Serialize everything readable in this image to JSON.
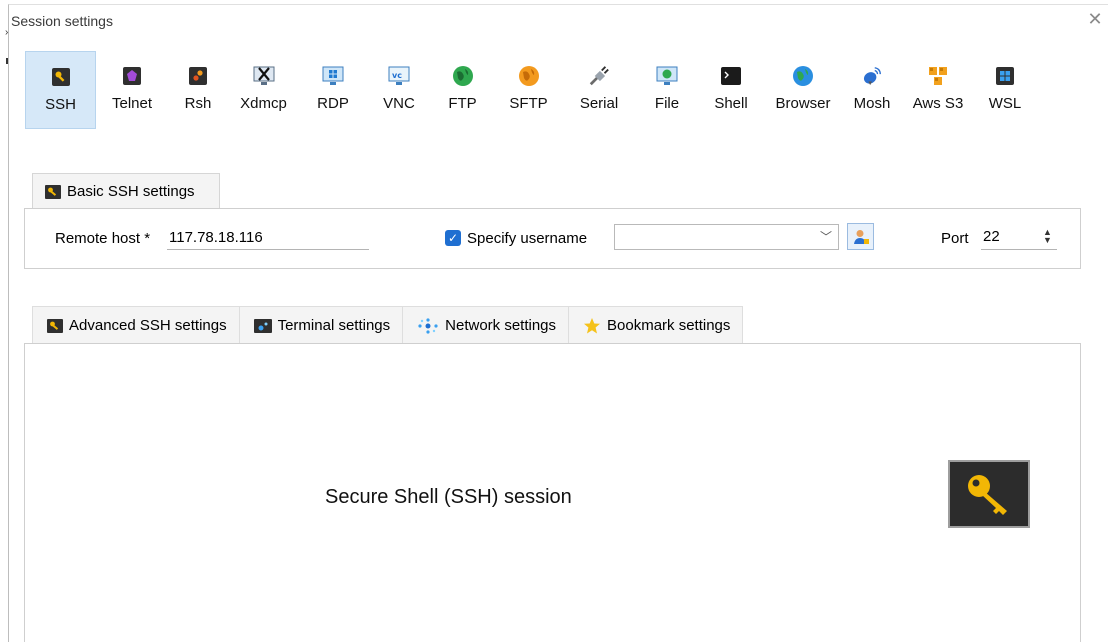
{
  "window": {
    "title": "Session settings",
    "close_glyph": "✕"
  },
  "protocols": [
    {
      "label": "SSH",
      "icon": "ssh-key-icon",
      "active": true
    },
    {
      "label": "Telnet",
      "icon": "telnet-icon",
      "active": false
    },
    {
      "label": "Rsh",
      "icon": "rsh-icon",
      "active": false
    },
    {
      "label": "Xdmcp",
      "icon": "xdmcp-icon",
      "active": false
    },
    {
      "label": "RDP",
      "icon": "rdp-monitor-icon",
      "active": false
    },
    {
      "label": "VNC",
      "icon": "vnc-monitor-icon",
      "active": false
    },
    {
      "label": "FTP",
      "icon": "ftp-globe-icon",
      "active": false
    },
    {
      "label": "SFTP",
      "icon": "sftp-globe-icon",
      "active": false
    },
    {
      "label": "Serial",
      "icon": "serial-plug-icon",
      "active": false
    },
    {
      "label": "File",
      "icon": "file-monitor-icon",
      "active": false
    },
    {
      "label": "Shell",
      "icon": "shell-terminal-icon",
      "active": false
    },
    {
      "label": "Browser",
      "icon": "browser-globe-icon",
      "active": false
    },
    {
      "label": "Mosh",
      "icon": "mosh-satellite-icon",
      "active": false
    },
    {
      "label": "Aws S3",
      "icon": "aws-s3-icon",
      "active": false
    },
    {
      "label": "WSL",
      "icon": "wsl-windows-icon",
      "active": false
    }
  ],
  "basic": {
    "tab_label": "Basic SSH settings",
    "remote_host_label": "Remote host *",
    "remote_host_value": "117.78.18.116",
    "specify_username_label": "Specify username",
    "specify_username_checked": true,
    "username_value": "",
    "port_label": "Port",
    "port_value": "22"
  },
  "advanced_tabs": [
    {
      "label": "Advanced SSH settings",
      "icon": "ssh-key-icon"
    },
    {
      "label": "Terminal settings",
      "icon": "terminal-icon"
    },
    {
      "label": "Network settings",
      "icon": "network-icon"
    },
    {
      "label": "Bookmark settings",
      "icon": "star-icon"
    }
  ],
  "panel": {
    "description": "Secure Shell (SSH) session"
  },
  "colors": {
    "active_bg": "#d6e8f8",
    "checkbox": "#1f6fd1",
    "key_yellow": "#f2b705",
    "globe_green": "#2fa84f",
    "globe_orange": "#f39a1e"
  }
}
